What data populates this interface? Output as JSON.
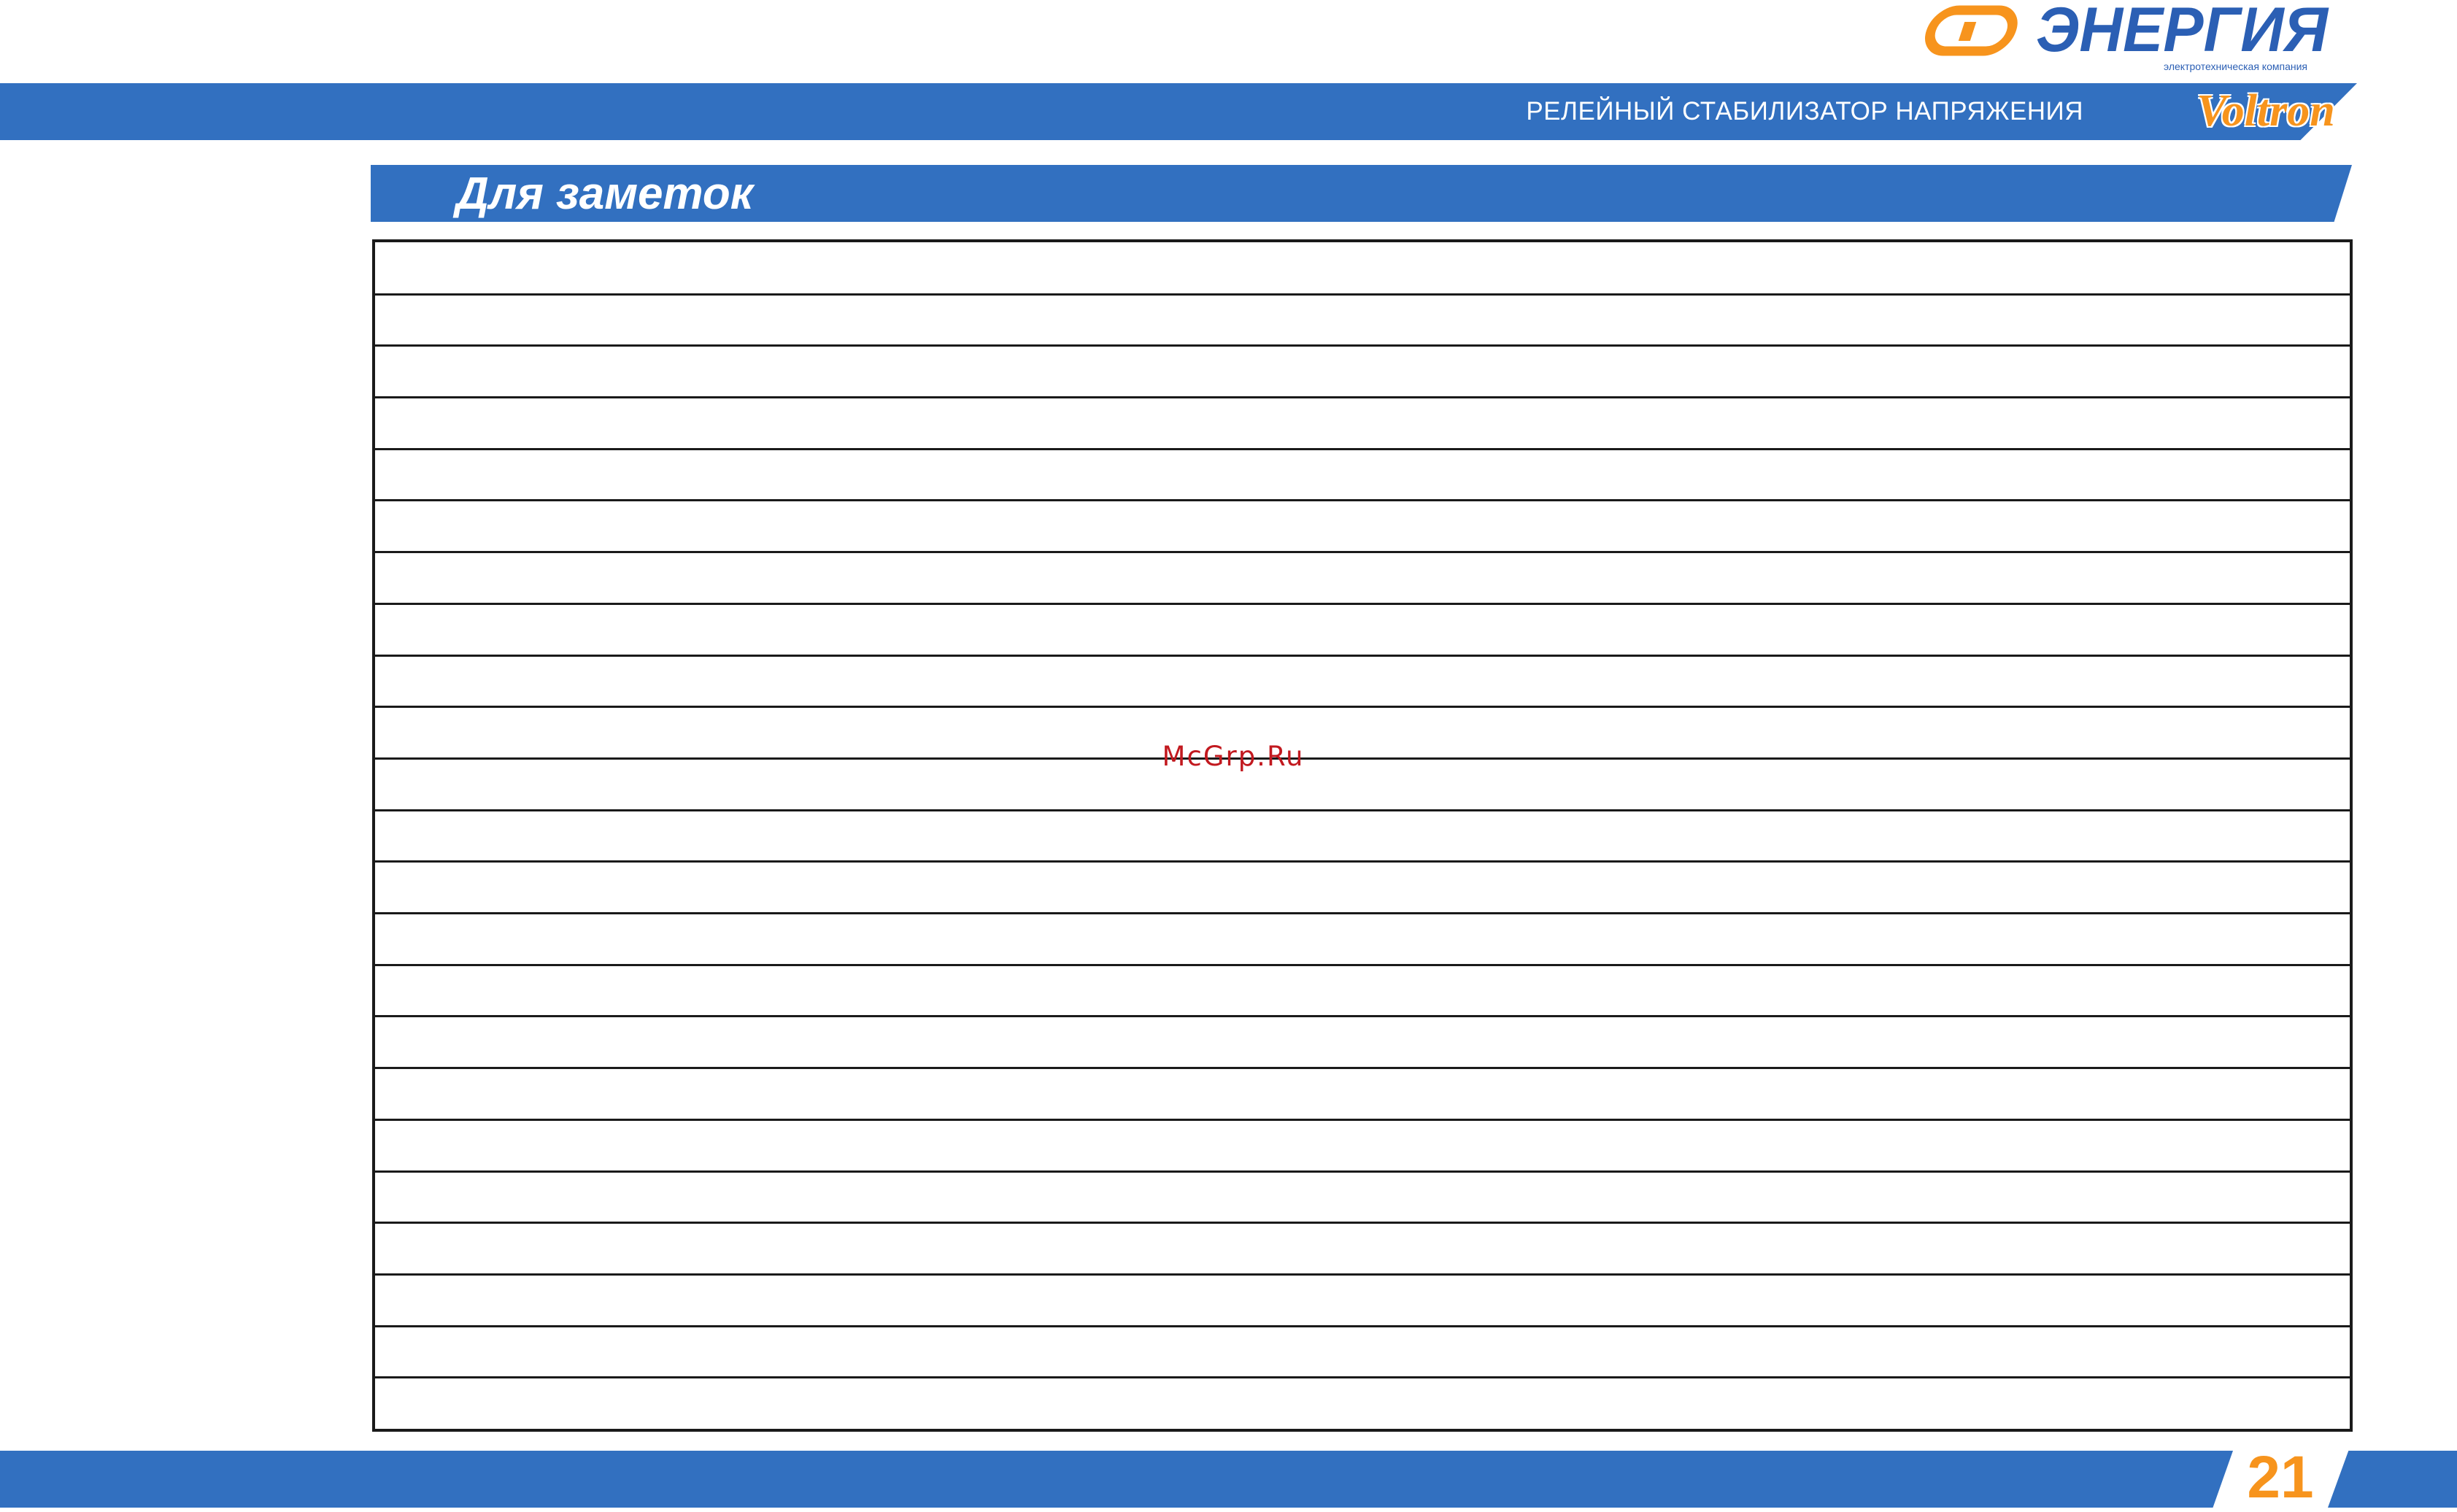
{
  "header": {
    "company_name": "ЭНЕРГИЯ",
    "company_tagline": "электротехническая компания",
    "subtitle": "РЕЛЕЙНЫЙ СТАБИЛИЗАТОР НАПРЯЖЕНИЯ",
    "product_brand": "Voltron"
  },
  "section": {
    "title": "Для заметок"
  },
  "notes": {
    "line_count": 23
  },
  "watermark": "McGrp.Ru",
  "footer": {
    "page_number": "21"
  },
  "colors": {
    "band_blue": "#3270c0",
    "accent_orange": "#f7941d",
    "logo_blue": "#2b5fb4",
    "watermark_red": "#c2191f"
  }
}
